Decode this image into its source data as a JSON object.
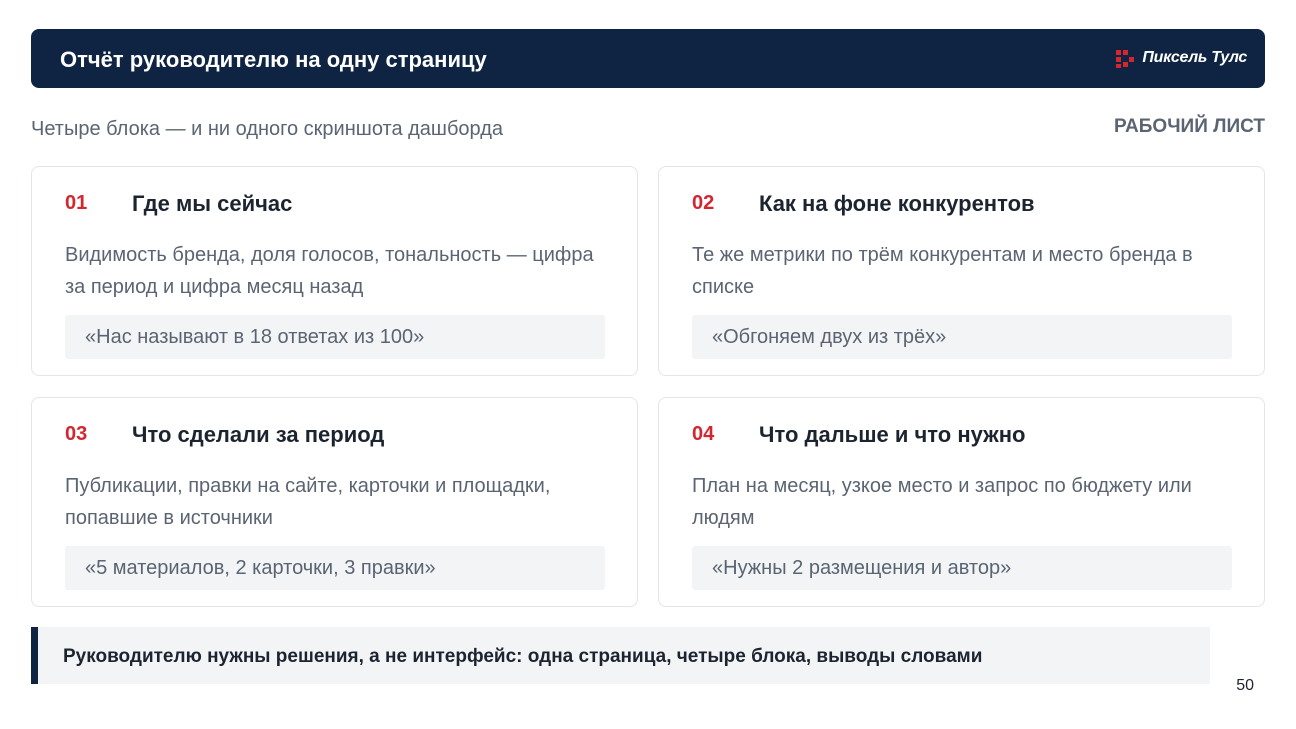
{
  "header": {
    "title": "Отчёт руководителю на одну страницу",
    "brand_name": "Пиксель Тулс",
    "brand_color": "#d3262f",
    "background_color": "#0f2442"
  },
  "subtitle": "Четыре блока — и ни одного скриншота дашборда",
  "worksheet_label": "РАБОЧИЙ ЛИСТ",
  "cards": [
    {
      "number": "01",
      "title": "Где мы сейчас",
      "text": "Видимость бренда, доля голосов, тональность — цифра за период и цифра месяц назад",
      "quote": "«Нас называют в 18 ответах из 100»"
    },
    {
      "number": "02",
      "title": "Как на фоне конкурентов",
      "text": "Те же метрики по трём конкурентам и место бренда в списке",
      "quote": "«Обгоняем двух из трёх»"
    },
    {
      "number": "03",
      "title": "Что сделали за период",
      "text": "Публикации, правки на сайте, карточки и площадки, попавшие в источники",
      "quote": "«5 материалов, 2 карточки, 3 правки»"
    },
    {
      "number": "04",
      "title": "Что дальше и что нужно",
      "text": "План на месяц, узкое место и запрос по бюджету или людям",
      "quote": "«Нужны 2 размещения и автор»"
    }
  ],
  "conclusion": "Руководителю нужны решения, а не интерфейс: одна страница, четыре блока, выводы словами",
  "page_number": "50"
}
